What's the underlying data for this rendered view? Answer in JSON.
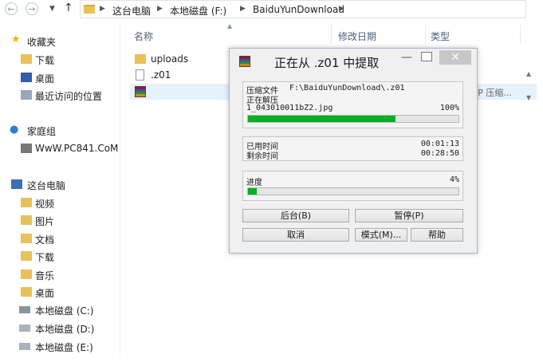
{
  "address_bar": {
    "crumbs": [
      "这台电脑",
      "本地磁盘 (F:)",
      "BaiduYunDownload"
    ]
  },
  "sidebar": {
    "favorites_label": "收藏夹",
    "favorites": [
      "下载",
      "桌面",
      "最近访问的位置"
    ],
    "homegroup_label": "家庭组",
    "homegroup_user": "WwW.PC841.CoM",
    "thispc_label": "这台电脑",
    "thispc_items": [
      "视频",
      "图片",
      "文档",
      "下载",
      "音乐",
      "桌面",
      "本地磁盘 (C:)",
      "本地磁盘 (D:)",
      "本地磁盘 (E:)"
    ]
  },
  "columns": {
    "name": "名称",
    "date": "修改日期",
    "type": "类型"
  },
  "files": [
    {
      "name": "uploads"
    },
    {
      "name": ".z01"
    },
    {
      "name": "",
      "type": "IP 压缩..."
    }
  ],
  "dialog": {
    "title": "正在从 .z01 中提取",
    "archive_label": "压缩文件",
    "archive_path": "F:\\BaiduYunDownload\\.z01",
    "status": "正在解压",
    "current_file": "1_043010011bZ2.jpg",
    "file_percent_text": "100%",
    "file_progress": 0.7,
    "elapsed_label": "已用时间",
    "elapsed_value": "00:01:13",
    "remaining_label": "剩余时间",
    "remaining_value": "00:28:50",
    "progress_label": "进度",
    "total_percent_text": "4%",
    "total_progress": 0.04,
    "buttons": {
      "background": "后台(B)",
      "pause": "暂停(P)",
      "cancel": "取消",
      "mode": "模式(M)...",
      "help": "帮助"
    }
  },
  "colors": {
    "progress": "#06b025",
    "accent": "#4c607a"
  }
}
